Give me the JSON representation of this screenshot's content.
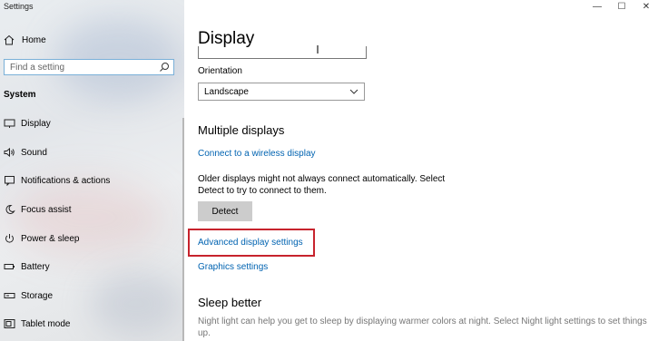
{
  "app_title": "Settings",
  "window_controls": {
    "minimize": "—",
    "maximize": "☐",
    "close": "✕"
  },
  "sidebar": {
    "home_label": "Home",
    "search_placeholder": "Find a setting",
    "section_label": "System",
    "items": [
      {
        "label": "Display",
        "icon": "monitor-icon"
      },
      {
        "label": "Sound",
        "icon": "speaker-icon"
      },
      {
        "label": "Notifications & actions",
        "icon": "notification-icon"
      },
      {
        "label": "Focus assist",
        "icon": "moon-icon"
      },
      {
        "label": "Power & sleep",
        "icon": "power-icon"
      },
      {
        "label": "Battery",
        "icon": "battery-icon"
      },
      {
        "label": "Storage",
        "icon": "storage-icon"
      },
      {
        "label": "Tablet mode",
        "icon": "tablet-icon"
      }
    ]
  },
  "main": {
    "title": "Display",
    "orientation_label": "Orientation",
    "orientation_value": "Landscape",
    "multiple_displays_heading": "Multiple displays",
    "connect_wireless_link": "Connect to a wireless display",
    "older_displays_text_line1": "Older displays might not always connect automatically. Select",
    "older_displays_text_line2": "Detect to try to connect to them.",
    "detect_button": "Detect",
    "advanced_display_link": "Advanced display settings",
    "graphics_settings_link": "Graphics settings",
    "sleep_heading": "Sleep better",
    "sleep_text_line1": "Night light can help you get to sleep by displaying warmer colors at night. Select Night light settings to set things",
    "sleep_text_line2": "up."
  },
  "colors": {
    "link": "#0063b1",
    "highlight": "#c7232d",
    "button": "#cccccc"
  }
}
